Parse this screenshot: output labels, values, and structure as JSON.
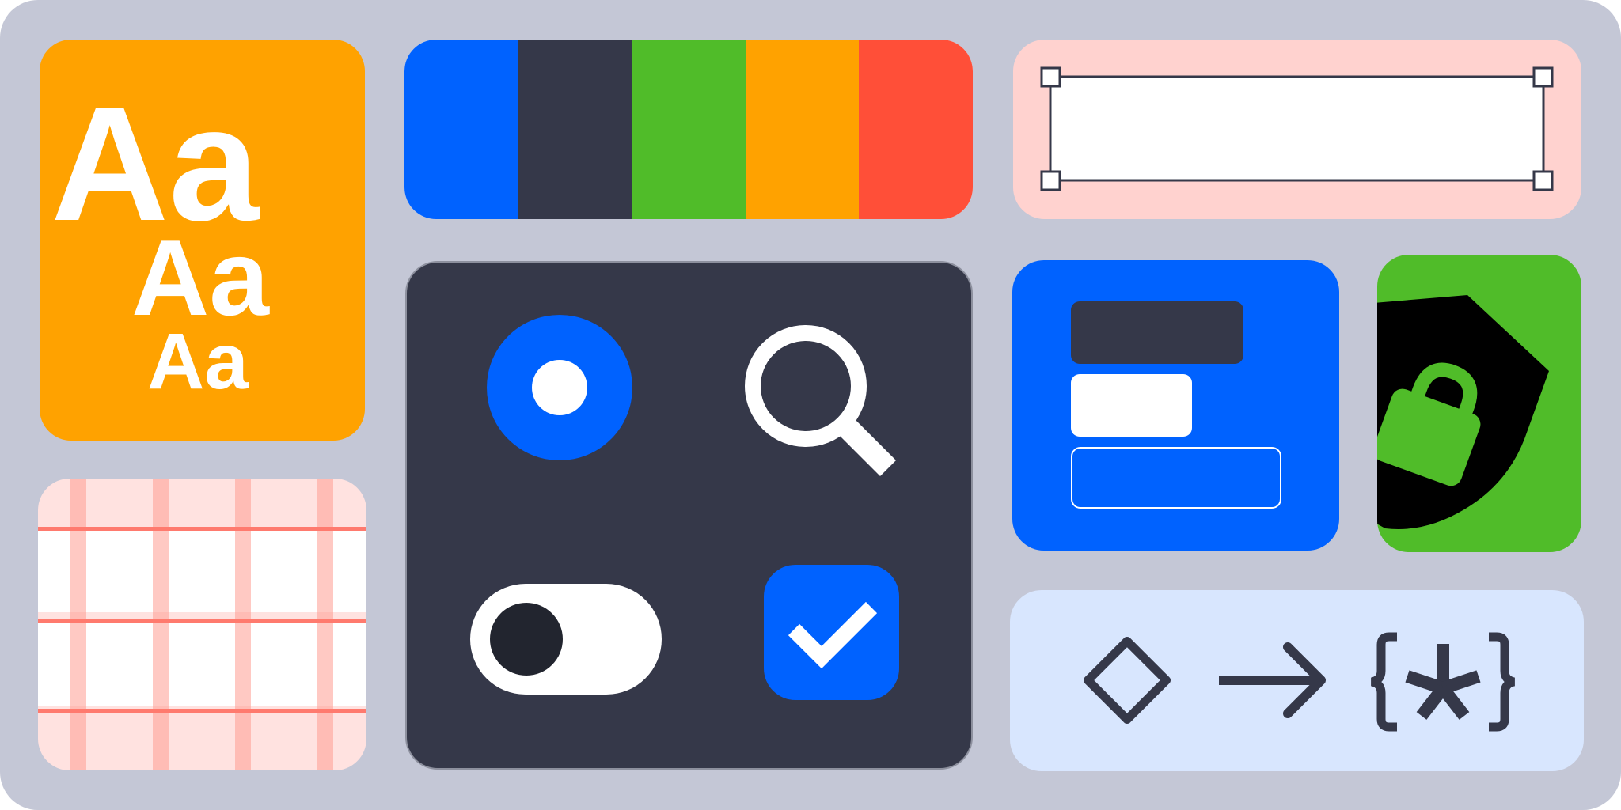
{
  "typography_card": {
    "samples": [
      "Aa",
      "Aa",
      "Aa"
    ]
  },
  "palette_card": {
    "swatches": [
      "#0062ff",
      "#353849",
      "#50bc29",
      "#ffa200",
      "#ff4f38"
    ]
  },
  "colors": {
    "background": "#c4c7d6",
    "typography_card": "#ffa200",
    "palette_card_bg": "#ffffff",
    "selection_card": "#ffd2cf",
    "grid_card": "#ffe2e0",
    "controls_panel": "#353849",
    "accent_blue": "#0062ff",
    "form_card": "#0062ff",
    "security_card": "#50bc29",
    "code_card": "#d8e6fe",
    "dark_ink": "#353849",
    "white": "#ffffff"
  },
  "controls": {
    "radio_selected": true,
    "toggle_on": false,
    "checkbox_checked": true
  },
  "icons": {
    "search": "search-icon",
    "lock": "lock-icon",
    "shield": "shield-icon",
    "diamond": "diamond-icon",
    "arrow": "arrow-right-icon",
    "code": "curly-braces-asterisk-icon"
  }
}
